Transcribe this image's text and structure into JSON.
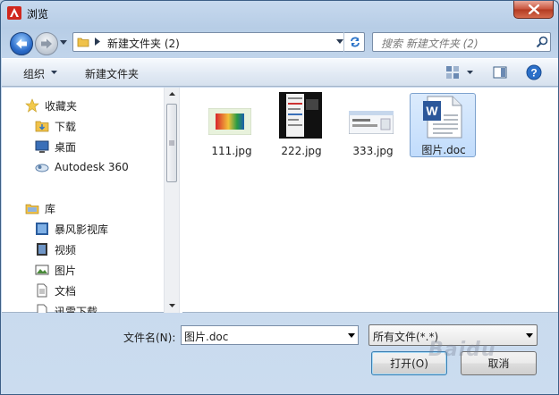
{
  "window": {
    "title": "浏览"
  },
  "address": {
    "path": "新建文件夹 (2)"
  },
  "search": {
    "placeholder": "搜索 新建文件夹 (2)"
  },
  "toolbar": {
    "organize_label": "组织",
    "new_folder_label": "新建文件夹"
  },
  "nav": {
    "items": [
      {
        "label": "收藏夹",
        "icon": "star-icon"
      },
      {
        "label": "下载",
        "icon": "downloads-folder-icon"
      },
      {
        "label": "桌面",
        "icon": "desktop-icon"
      },
      {
        "label": "Autodesk 360",
        "icon": "cloud-icon"
      },
      {
        "label": "库",
        "icon": "library-icon"
      },
      {
        "label": "暴风影视库",
        "icon": "video-library-icon"
      },
      {
        "label": "视频",
        "icon": "video-icon"
      },
      {
        "label": "图片",
        "icon": "pictures-icon"
      },
      {
        "label": "文档",
        "icon": "documents-icon"
      },
      {
        "label": "迅雷下载",
        "icon": "download-icon"
      }
    ]
  },
  "files": [
    {
      "name": "111.jpg",
      "type": "image"
    },
    {
      "name": "222.jpg",
      "type": "image"
    },
    {
      "name": "333.jpg",
      "type": "image"
    },
    {
      "name": "图片.doc",
      "type": "word-document",
      "selected": true
    }
  ],
  "filename": {
    "label": "文件名(N):",
    "value": "图片.doc"
  },
  "filetype": {
    "selected": "所有文件(*.*)"
  },
  "buttons": {
    "open_label": "打开(O)",
    "cancel_label": "取消"
  },
  "watermark": "Baidu",
  "colors": {
    "close": "#c8513a",
    "selection": "#c1dcfc",
    "title_gradient": "#c7d9ee"
  }
}
